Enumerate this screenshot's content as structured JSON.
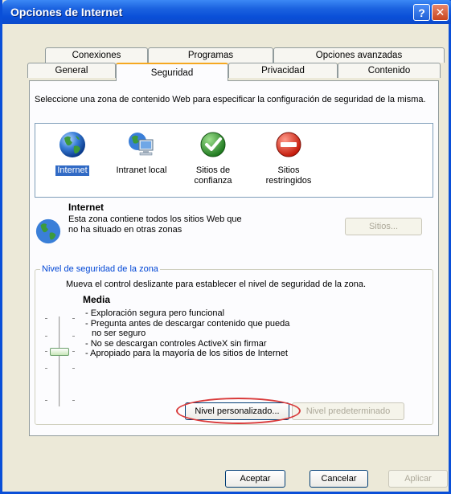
{
  "window": {
    "title": "Opciones de Internet",
    "help_label": "?",
    "close_label": "✕"
  },
  "tabs": {
    "row_top": [
      "Conexiones",
      "Programas",
      "Opciones avanzadas"
    ],
    "row_bottom": [
      "General",
      "Seguridad",
      "Privacidad",
      "Contenido"
    ],
    "active": "Seguridad"
  },
  "security": {
    "intro": "Seleccione una zona de contenido Web para especificar la configuración de seguridad de la misma.",
    "zones": [
      {
        "label": "Internet",
        "icon": "globe-icon",
        "selected": true
      },
      {
        "label": "Intranet local",
        "icon": "intranet-computer-icon",
        "selected": false
      },
      {
        "label": "Sitios de confianza",
        "icon": "check-icon",
        "selected": false
      },
      {
        "label": "Sitios restringidos",
        "icon": "no-entry-icon",
        "selected": false
      }
    ],
    "selected_zone": {
      "title": "Internet",
      "description": "Esta zona contiene todos los sitios Web que no ha situado en otras zonas",
      "sites_button": "Sitios..."
    },
    "level_group": {
      "legend": "Nivel de seguridad de la zona",
      "instruction": "Mueva el control deslizante para establecer el nivel de seguridad de la zona.",
      "level_name": "Media",
      "bullets": [
        "- Exploración segura pero funcional",
        "- Pregunta antes de descargar contenido que pueda",
        "   no ser seguro",
        "- No se descargan controles ActiveX sin firmar",
        "- Apropiado para la mayoría de los sitios de Internet"
      ],
      "custom_button": "Nivel personalizado...",
      "default_button": "Nivel predeterminado"
    }
  },
  "footer": {
    "ok": "Aceptar",
    "cancel": "Cancelar",
    "apply": "Aplicar"
  },
  "colors": {
    "titlebar": "#0a4fd8",
    "selection": "#316ac5",
    "annotation": "#d93a3a"
  }
}
